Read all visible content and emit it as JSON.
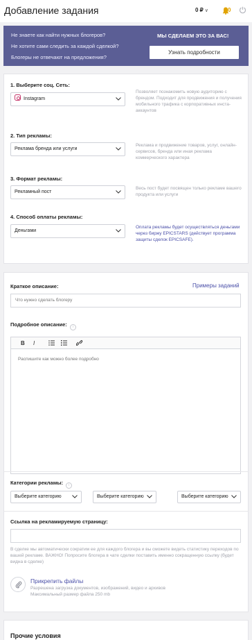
{
  "header": {
    "title": "Добавление задания",
    "balance": "0 ₽",
    "notifications": "0"
  },
  "banner": {
    "questions": [
      "Не знаете как найти нужных блогеров?",
      "Не хотите сами следить за каждой сделкой?",
      "Блогеры не отвечают на предложения?"
    ],
    "promo": "МЫ СДЕЛАЕМ ЭТО ЗА ВАС!",
    "button": "Узнать подробности"
  },
  "steps": [
    {
      "label": "1. Выберите соц. Сеть:",
      "value": "Instagram",
      "help": "Позволяет познакомить новую аудиторию с брендом. Подходит для продвижения и получения мобильного трафика с корпоративных инста-аккаунтов"
    },
    {
      "label": "2. Тип рекламы:",
      "value": "Реклама бренда или услуги",
      "help": "Реклама и продвижение товаров, услуг, онлайн-сервисов, бренда или иная реклама коммерческого характера"
    },
    {
      "label": "3. Формат рекламы:",
      "value": "Рекламный пост",
      "help": "Весь пост будет посвящен только рекламе вашего продукта или услуги"
    },
    {
      "label": "4. Способ оплаты рекламы:",
      "value": "Деньгами",
      "help": "Оплата рекламы будет осуществляться деньгами через биржу EPICSTARS (действует программа защиты сделок EPICSAFE)."
    }
  ],
  "form": {
    "short_label": "Краткое описание:",
    "examples_link": "Примеры заданий",
    "short_placeholder": "Что нужно сделать блогеру",
    "detail_label": "Подробное описание:",
    "detail_placeholder": "Распишите как можно более подробно",
    "toolbar": {
      "bold": "B",
      "italic": "I",
      "ul": "☰",
      "ol": "☷",
      "link": "🔗"
    },
    "categories_label": "Категории рекламы:",
    "category_placeholder": "Выберите категорию",
    "link_label": "Ссылка на рекламируемую страницу:",
    "link_note": "В сделке мы автоматически сократим ее для каждого блогера и вы сможете видеть статистику переходов по вашей рекламе. ВАЖНО! Попросите блогера в чате сделки поставить именно сокращенную ссылку (будет видна в сделке)",
    "attach_label": "Прикрепить файлы",
    "attach_note1": "Разрешена загрузка документов, изображений, видео и архивов",
    "attach_note2": "Максимальный размер файла 250 mb"
  },
  "other": {
    "title": "Прочие условия"
  },
  "colors": {
    "banner": "#5b5e95",
    "link": "#4a4fa8",
    "bell": "#e1a300"
  },
  "icons": [
    "bell-icon",
    "logout-icon",
    "instagram-icon",
    "chevron-down-icon",
    "info-icon",
    "paperclip-icon",
    "link-icon"
  ]
}
